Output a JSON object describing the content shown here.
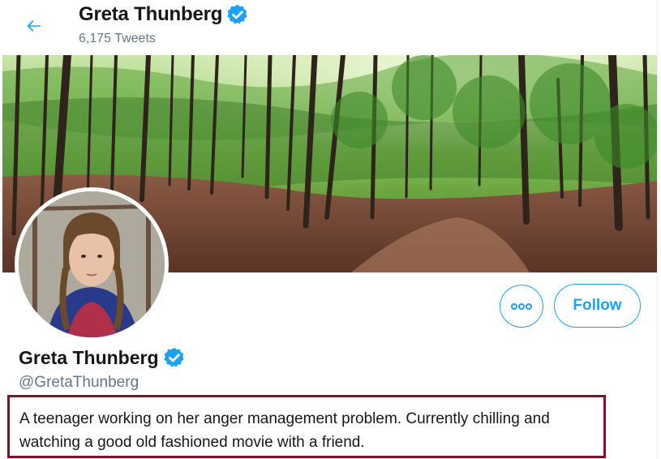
{
  "header": {
    "name": "Greta Thunberg",
    "tweet_count": "6,175 Tweets",
    "back_icon": "arrow-left-icon"
  },
  "profile": {
    "name": "Greta Thunberg",
    "handle": "@GretaThunberg",
    "bio": "A teenager working on her anger management problem. Currently chilling and watching a good old fashioned movie with a friend.",
    "verified": true
  },
  "actions": {
    "more_icon": "more-options-icon",
    "follow_label": "Follow"
  },
  "colors": {
    "accent": "#1da1f2",
    "verified": "#1da1f2",
    "secondary_text": "#657786",
    "highlight_border": "#7a1426"
  }
}
